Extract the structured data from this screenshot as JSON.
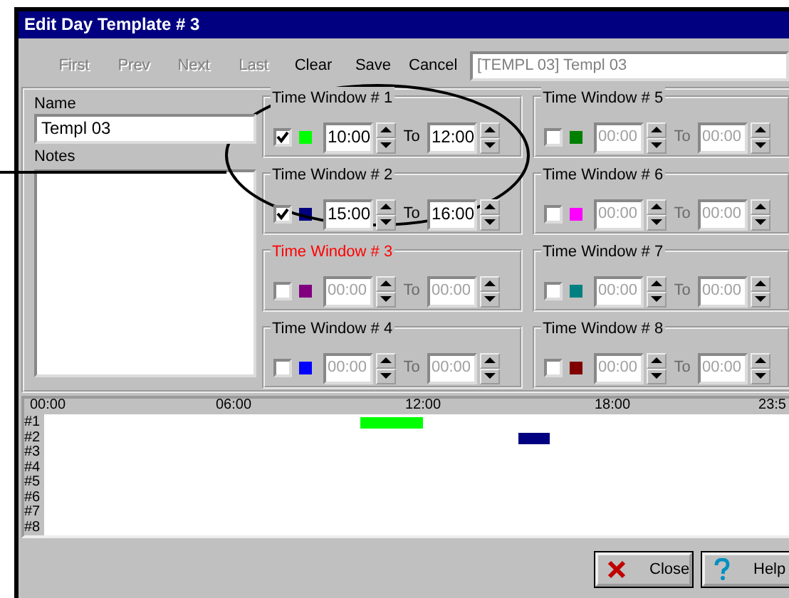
{
  "window": {
    "title": "Edit Day Template # 3"
  },
  "toolbar": {
    "buttons": [
      {
        "label": "First",
        "disabled": true
      },
      {
        "label": "Prev",
        "disabled": true
      },
      {
        "label": "Next",
        "disabled": true
      },
      {
        "label": "Last",
        "disabled": true
      },
      {
        "label": "Clear",
        "disabled": false
      },
      {
        "label": "Save",
        "disabled": false
      },
      {
        "label": "Cancel",
        "disabled": false
      }
    ],
    "template_select": {
      "value": "[TEMPL 03] Templ 03",
      "disabled": true
    }
  },
  "name": {
    "label": "Name",
    "value": "Templ 03"
  },
  "notes": {
    "label": "Notes"
  },
  "time_windows": [
    {
      "title": "Time Window # 1",
      "checked": true,
      "highlighted": false,
      "color": "#00ff00",
      "from": "10:00",
      "to_label": "To",
      "to": "12:00"
    },
    {
      "title": "Time Window # 2",
      "checked": true,
      "highlighted": false,
      "color": "#000080",
      "from": "15:00",
      "to_label": "To",
      "to": "16:00"
    },
    {
      "title": "Time Window # 3",
      "checked": false,
      "highlighted": true,
      "color": "#800080",
      "from": "00:00",
      "to_label": "To",
      "to": "00:00"
    },
    {
      "title": "Time Window # 4",
      "checked": false,
      "highlighted": false,
      "color": "#0000ff",
      "from": "00:00",
      "to_label": "To",
      "to": "00:00"
    },
    {
      "title": "Time Window # 5",
      "checked": false,
      "highlighted": false,
      "color": "#008000",
      "from": "00:00",
      "to_label": "To",
      "to": "00:00"
    },
    {
      "title": "Time Window # 6",
      "checked": false,
      "highlighted": false,
      "color": "#ff00ff",
      "from": "00:00",
      "to_label": "To",
      "to": "00:00"
    },
    {
      "title": "Time Window # 7",
      "checked": false,
      "highlighted": false,
      "color": "#008080",
      "from": "00:00",
      "to_label": "To",
      "to": "00:00"
    },
    {
      "title": "Time Window # 8",
      "checked": false,
      "highlighted": false,
      "color": "#800000",
      "from": "00:00",
      "to_label": "To",
      "to": "00:00"
    }
  ],
  "timeline": {
    "ticks": [
      "00:00",
      "06:00",
      "12:00",
      "18:00",
      "23:5"
    ],
    "rows": [
      "#1",
      "#2",
      "#3",
      "#4",
      "#5",
      "#6",
      "#7",
      "#8"
    ]
  },
  "buttons": [
    {
      "label": "Close",
      "kind": "close"
    },
    {
      "label": "Help",
      "kind": "help"
    }
  ]
}
